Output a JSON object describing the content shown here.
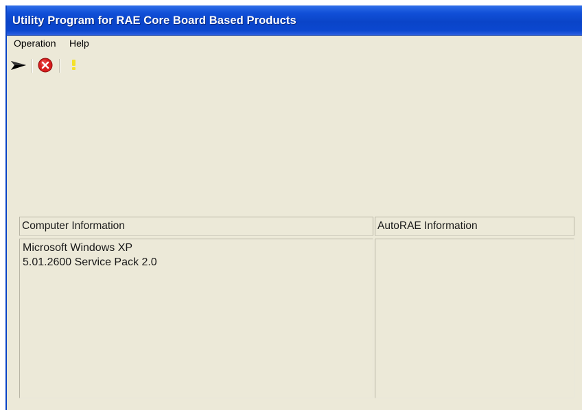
{
  "window": {
    "title": "Utility Program for RAE Core Board Based Products"
  },
  "menu": {
    "items": [
      "Operation",
      "Help"
    ]
  },
  "toolbar": {
    "icons": [
      "play-arrow-icon",
      "stop-icon",
      "info-icon"
    ]
  },
  "panels": {
    "computer": {
      "header": "Computer Information",
      "lines": [
        "Microsoft Windows XP",
        "5.01.2600 Service Pack 2.0"
      ]
    },
    "autorae": {
      "header": "AutoRAE Information",
      "lines": []
    }
  }
}
